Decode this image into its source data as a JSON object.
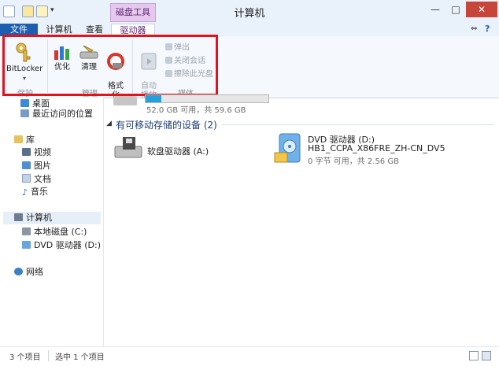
{
  "window": {
    "title": "计算机"
  },
  "contextual_tab": {
    "header": "磁盘工具"
  },
  "tabs": [
    {
      "label": "文件"
    },
    {
      "label": "计算机"
    },
    {
      "label": "查看"
    },
    {
      "label": "驱动器"
    }
  ],
  "ribbon": {
    "groups": {
      "protect": {
        "label": "保护",
        "bitlocker": "BitLocker"
      },
      "manage": {
        "label": "管理",
        "optimize": "优化",
        "cleanup": "清理",
        "format": "格式\n化"
      },
      "media": {
        "label": "媒体",
        "autoplay": "自动\n播放",
        "eject": "弹出",
        "close_session": "关闭会话",
        "erase_disc": "擦除此光盘"
      }
    }
  },
  "nav": {
    "desktop": "桌面",
    "recent": "最近访问的位置",
    "libraries": "库",
    "videos": "视频",
    "pictures": "图片",
    "documents": "文档",
    "music": "音乐",
    "computer": "计算机",
    "local_disk": "本地磁盘 (C:)",
    "dvd": "DVD 驱动器 (D:) HB",
    "network": "网络"
  },
  "content": {
    "hard_disk": {
      "free_text": "52.0 GB 可用，共 59.6 GB",
      "used_fraction": 0.13
    },
    "removable_section": "有可移动存储的设备 (2)",
    "floppy": {
      "name": "软盘驱动器 (A:)"
    },
    "dvd": {
      "name": "DVD 驱动器 (D:)",
      "label": "HB1_CCPA_X86FRE_ZH-CN_DV5",
      "free_text": "0 字节 可用，共 2.56 GB"
    }
  },
  "status": {
    "count": "3 个项目",
    "selected": "选中 1 个项目"
  },
  "colors": {
    "accent": "#1c5eb0",
    "highlight": "#e0141e",
    "contextual": "#e6c8ef"
  }
}
